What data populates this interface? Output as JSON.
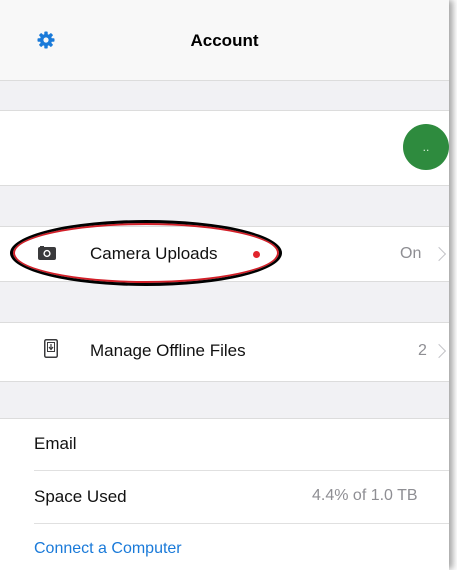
{
  "header": {
    "title": "Account",
    "settings_icon": "gear-icon"
  },
  "profile": {
    "avatar_text": ".."
  },
  "camera_uploads": {
    "label": "Camera Uploads",
    "value": "On",
    "icon": "camera-icon",
    "status_dot_color": "#e1252c"
  },
  "offline_files": {
    "label": "Manage Offline Files",
    "value": "2",
    "icon": "offline-file-icon"
  },
  "account_info": {
    "email_label": "Email",
    "space_label": "Space Used",
    "space_value": "4.4% of 1.0 TB",
    "connect_label": "Connect a Computer"
  },
  "colors": {
    "accent": "#1a7ad9",
    "avatar": "#2e8b3e",
    "highlight": "#d21f28"
  }
}
